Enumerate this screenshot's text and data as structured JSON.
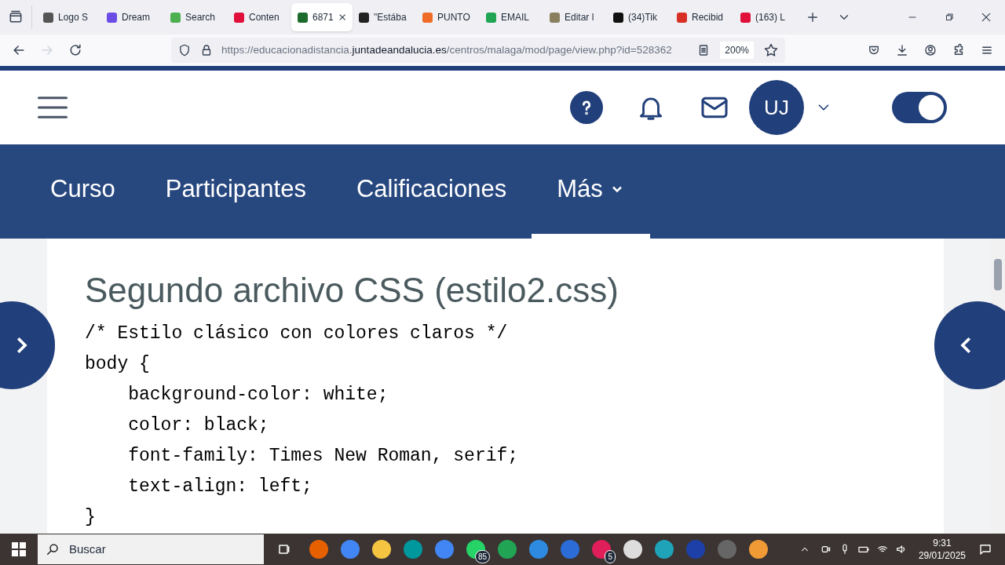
{
  "browser": {
    "tabs": [
      {
        "label": "Logo S",
        "selected": false,
        "color": "#555555"
      },
      {
        "label": "Dream",
        "selected": false,
        "color": "#6b4de6"
      },
      {
        "label": "Search",
        "selected": false,
        "color": "#4caf50"
      },
      {
        "label": "Conten",
        "selected": false,
        "color": "#e0103b"
      },
      {
        "label": "6871",
        "selected": true,
        "color": "#1d6b2c"
      },
      {
        "label": "\"Estába",
        "selected": false,
        "color": "#222222"
      },
      {
        "label": "PUNTO",
        "selected": false,
        "color": "#ef6c28"
      },
      {
        "label": "EMAIL",
        "selected": false,
        "color": "#21a453"
      },
      {
        "label": "Editar l",
        "selected": false,
        "color": "#8a8060"
      },
      {
        "label": "(34)Tik",
        "selected": false,
        "color": "#111111"
      },
      {
        "label": "Recibid",
        "selected": false,
        "color": "#d93025"
      },
      {
        "label": "(163) L",
        "selected": false,
        "color": "#e0103b"
      }
    ],
    "url_prefix": "https://educacionadistancia.",
    "url_domain": "juntadeandalucia.es",
    "url_path": "/centros/malaga/mod/page/view.php?id=528362",
    "zoom": "200%"
  },
  "header": {
    "avatar": "UJ",
    "theme_toggle": {
      "on": true
    }
  },
  "nav": [
    {
      "label": "Curso",
      "selected": false
    },
    {
      "label": "Participantes",
      "selected": false
    },
    {
      "label": "Calificaciones",
      "selected": false
    },
    {
      "label": "Más",
      "selected": true
    }
  ],
  "content": {
    "heading": "Segundo archivo CSS (estilo2.css)",
    "code": [
      "/* Estilo clásico con colores claros */",
      "body {",
      "    background-color: white;",
      "    color: black;",
      "    font-family: Times New Roman, serif;",
      "    text-align: left;",
      "}"
    ]
  },
  "taskbar": {
    "search_placeholder": "Buscar",
    "badges": [
      "85",
      "5"
    ],
    "time": "9:31",
    "date": "29/01/2025"
  }
}
